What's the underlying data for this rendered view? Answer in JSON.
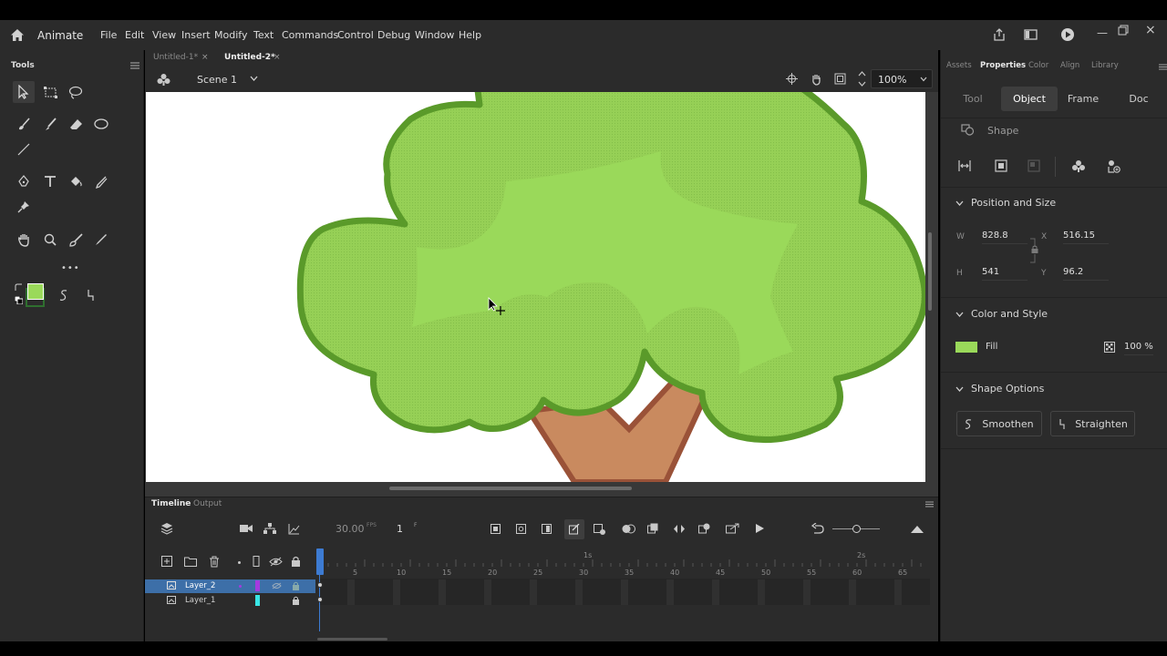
{
  "app": {
    "name": "Animate",
    "menu": [
      "File",
      "Edit",
      "View",
      "Insert",
      "Modify",
      "Text",
      "Commands",
      "Control",
      "Debug",
      "Window",
      "Help"
    ]
  },
  "tools_panel": {
    "title": "Tools",
    "more": "•••"
  },
  "doc_tabs": [
    {
      "label": "Untitled-1*",
      "active": false
    },
    {
      "label": "Untitled-2*",
      "active": true
    }
  ],
  "close_glyph": "×",
  "stage_bar": {
    "scene": "Scene 1",
    "zoom": "100%"
  },
  "properties": {
    "tabs": [
      {
        "label": "Assets",
        "active": false
      },
      {
        "label": "Properties",
        "active": true
      },
      {
        "label": "Color",
        "active": false
      },
      {
        "label": "Align",
        "active": false
      },
      {
        "label": "Library",
        "active": false
      }
    ],
    "subtabs": [
      {
        "label": "Tool",
        "active": false
      },
      {
        "label": "Object",
        "active": true
      },
      {
        "label": "Frame",
        "active": false
      },
      {
        "label": "Doc",
        "active": false
      }
    ],
    "object_type": "Shape",
    "position_size": {
      "title": "Position and Size",
      "w_label": "W",
      "w": "828.8",
      "h_label": "H",
      "h": "541",
      "x_label": "X",
      "x": "516.15",
      "y_label": "Y",
      "y": "96.2"
    },
    "color_style": {
      "title": "Color and Style",
      "fill_label": "Fill",
      "fill_color": "#9ad95a",
      "alpha": "100 %"
    },
    "shape_options": {
      "title": "Shape Options",
      "smoothen": "Smoothen",
      "straighten": "Straighten"
    }
  },
  "timeline": {
    "tabs": [
      {
        "label": "Timeline",
        "active": true
      },
      {
        "label": "Output",
        "active": false
      }
    ],
    "fps": "30.00",
    "fps_unit": "FPS",
    "frame": "1",
    "frame_unit": "F",
    "second_marks": [
      "1s",
      "2s"
    ],
    "frame_numbers": [
      "5",
      "10",
      "15",
      "20",
      "25",
      "30",
      "35",
      "40",
      "45",
      "50",
      "55",
      "60",
      "65"
    ],
    "layers": [
      {
        "name": "Layer_2",
        "selected": true,
        "color": "#a53ae0"
      },
      {
        "name": "Layer_1",
        "selected": false,
        "color": "#39e6e6"
      }
    ]
  },
  "colors": {
    "stroke_swatch": "#2f6f2f",
    "fill_swatch": "#9ad95a",
    "tree_leaf_fill": "#9ad95a",
    "tree_leaf_stroke": "#5a9a2a",
    "trunk_fill": "#c98a5f",
    "trunk_stroke": "#9a5238",
    "accent": "#3d7bd2"
  }
}
